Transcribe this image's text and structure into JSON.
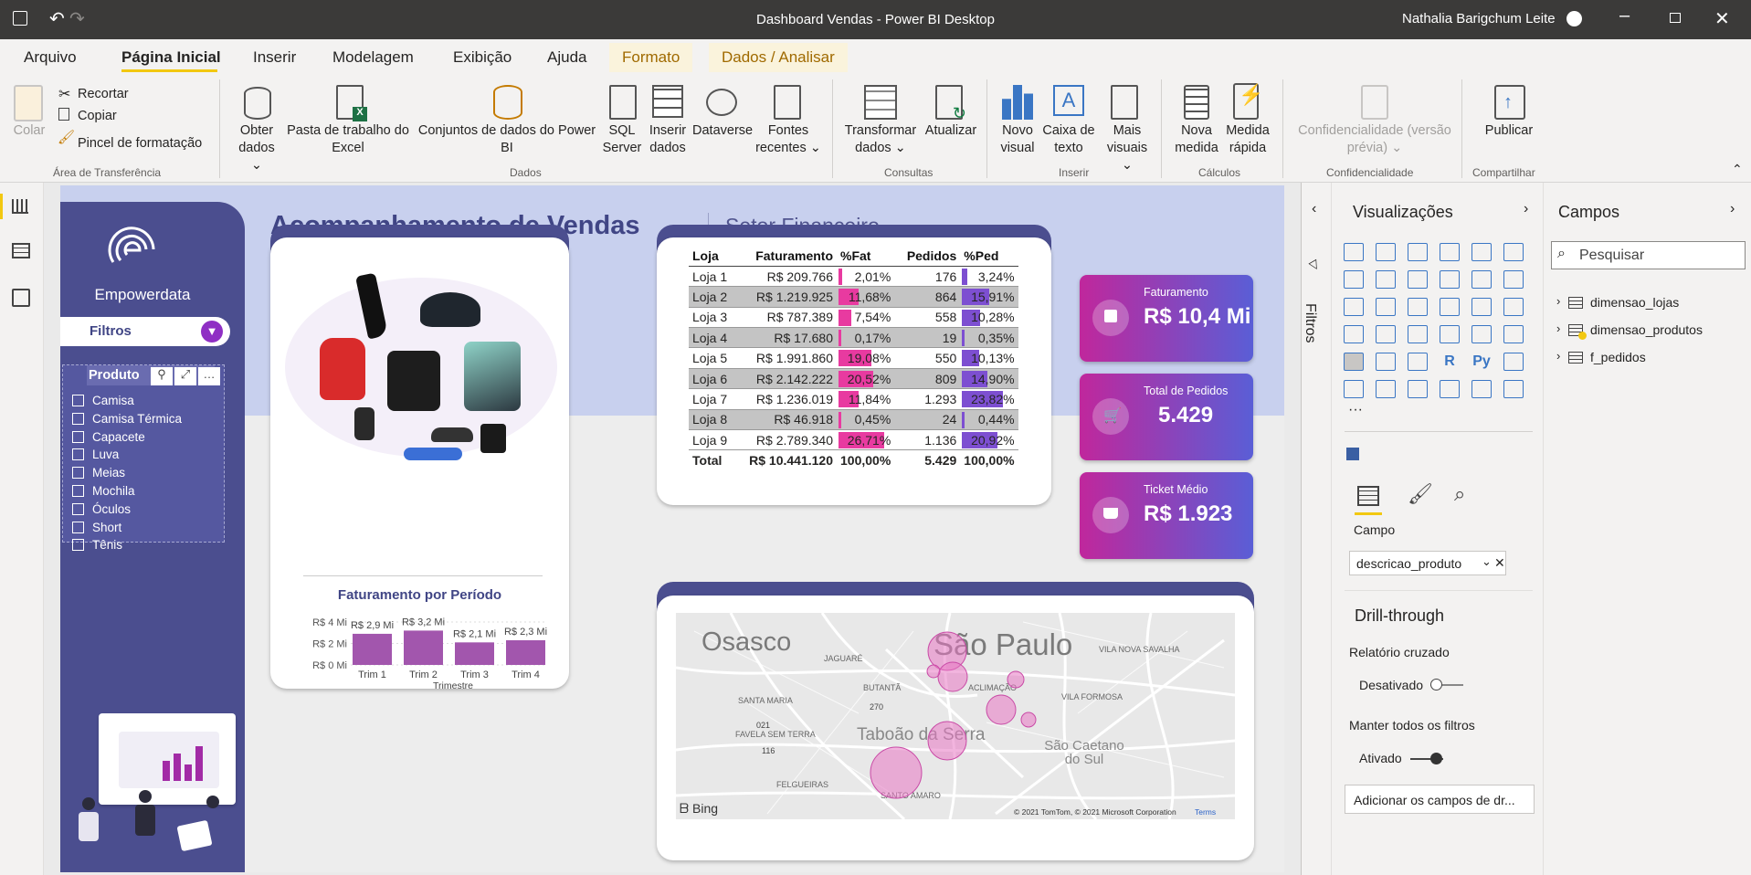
{
  "app": {
    "title": "Dashboard Vendas - Power BI Desktop",
    "user": "Nathalia Barigchum Leite"
  },
  "menu": [
    "Arquivo",
    "Página Inicial",
    "Inserir",
    "Modelagem",
    "Exibição",
    "Ajuda",
    "Formato",
    "Dados / Analisar"
  ],
  "ribbon": {
    "colar": "Colar",
    "recortar": "Recortar",
    "copiar": "Copiar",
    "pincel": "Pincel de formatação",
    "area": "Área de Transferência",
    "obter1": "Obter",
    "obter2": "dados",
    "pasta1": "Pasta de trabalho do",
    "pasta2": "Excel",
    "conj1": "Conjuntos de dados do Power",
    "conj2": "BI",
    "sql1": "SQL",
    "sql2": "Server",
    "ins1": "Inserir",
    "ins2": "dados",
    "dataverse": "Dataverse",
    "fontes1": "Fontes",
    "fontes2": "recentes",
    "dados": "Dados",
    "transf1": "Transformar",
    "transf2": "dados",
    "atualizar": "Atualizar",
    "consultas": "Consultas",
    "novo1": "Novo",
    "novo2": "visual",
    "caixa1": "Caixa de",
    "caixa2": "texto",
    "mais1": "Mais",
    "mais2": "visuais",
    "inserir": "Inserir",
    "nova1": "Nova",
    "nova2": "medida",
    "med1": "Medida",
    "med2": "rápida",
    "calculos": "Cálculos",
    "conf1": "Confidencialidade (versão",
    "conf2": "prévia)",
    "confg": "Confidencialidade",
    "publicar": "Publicar",
    "compartilhar": "Compartilhar"
  },
  "report": {
    "title": "Acompanhamento de Vendas",
    "subtitle": "Setor Financeiro",
    "logo": "Empowerdata",
    "filtros": "Filtros",
    "produto": "Produto",
    "products": [
      "Camisa",
      "Camisa Térmica",
      "Capacete",
      "Luva",
      "Meias",
      "Mochila",
      "Óculos",
      "Short",
      "Tênis"
    ],
    "table": {
      "headers": [
        "Loja",
        "Faturamento",
        "%Fat",
        "Pedidos",
        "%Ped"
      ],
      "rows": [
        [
          "Loja 1",
          "R$ 209.766",
          "2,01%",
          "176",
          "3,24%"
        ],
        [
          "Loja 2",
          "R$ 1.219.925",
          "11,68%",
          "864",
          "15,91%"
        ],
        [
          "Loja 3",
          "R$ 787.389",
          "7,54%",
          "558",
          "10,28%"
        ],
        [
          "Loja 4",
          "R$ 17.680",
          "0,17%",
          "19",
          "0,35%"
        ],
        [
          "Loja 5",
          "R$ 1.991.860",
          "19,08%",
          "550",
          "10,13%"
        ],
        [
          "Loja 6",
          "R$ 2.142.222",
          "20,52%",
          "809",
          "14,90%"
        ],
        [
          "Loja 7",
          "R$ 1.236.019",
          "11,84%",
          "1.293",
          "23,82%"
        ],
        [
          "Loja 8",
          "R$ 46.918",
          "0,45%",
          "24",
          "0,44%"
        ],
        [
          "Loja 9",
          "R$ 2.789.340",
          "26,71%",
          "1.136",
          "20,92%"
        ]
      ],
      "fat_pct": [
        2.01,
        11.68,
        7.54,
        0.17,
        19.08,
        20.52,
        11.84,
        0.45,
        26.71
      ],
      "ped_pct": [
        3.24,
        15.91,
        10.28,
        0.35,
        10.13,
        14.9,
        23.82,
        0.44,
        20.92
      ],
      "total": [
        "Total",
        "R$ 10.441.120",
        "100,00%",
        "5.429",
        "100,00%"
      ]
    },
    "kpis": [
      {
        "label": "Faturamento",
        "value": "R$ 10,4 Mi"
      },
      {
        "label": "Total de Pedidos",
        "value": "5.429"
      },
      {
        "label": "Ticket Médio",
        "value": "R$ 1.923"
      }
    ],
    "map": {
      "bing": "Bing",
      "copyright": "© 2021 TomTom, © 2021 Microsoft Corporation",
      "terms": "Terms",
      "places": [
        "Osasco",
        "São Paulo",
        "Taboão da Serra",
        "São Caetano do Sul",
        "JAGUARÉ",
        "BUTANTÃ",
        "ACLIMAÇÃO",
        "VILA NOVA SAVALHA",
        "VILA FORMOSA",
        "SANTA MARIA",
        "FAVELA SEM TERRA",
        "FELGUEIRAS",
        "SANTO AMARO",
        "270",
        "021",
        "116"
      ]
    }
  },
  "chart_data": {
    "type": "bar",
    "title": "Faturamento por Período",
    "categories": [
      "Trim 1",
      "Trim 2",
      "Trim 3",
      "Trim 4"
    ],
    "values": [
      2.9,
      3.2,
      2.1,
      2.3
    ],
    "data_labels": [
      "R$ 2,9 Mi",
      "R$ 3,2 Mi",
      "R$ 2,1 Mi",
      "R$ 2,3 Mi"
    ],
    "xlabel": "Trimestre",
    "ylabel": "",
    "yticks": [
      "R$ 0 Mi",
      "R$ 2 Mi",
      "R$ 4 Mi"
    ],
    "ylim": [
      0,
      4
    ],
    "color": "#a256ad"
  },
  "panes": {
    "filtros": "Filtros",
    "visualizacoes": "Visualizações",
    "campo": "Campo",
    "campo_value": "descricao_produto",
    "drill": "Drill-through",
    "rel": "Relatório cruzado",
    "desativado": "Desativado",
    "manter": "Manter todos os filtros",
    "ativado": "Ativado",
    "adicionar": "Adicionar os campos de dr...",
    "campos": "Campos",
    "pesquisar": "Pesquisar",
    "tables": [
      "dimensao_lojas",
      "dimensao_produtos",
      "f_pedidos"
    ]
  }
}
